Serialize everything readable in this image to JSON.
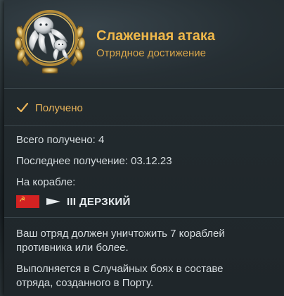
{
  "achievement": {
    "title": "Слаженная атака",
    "subtitle": "Отрядное достижение",
    "icon": "octopus-emblem-icon"
  },
  "status": {
    "icon": "checkmark-icon",
    "label": "Получено"
  },
  "stats": {
    "total_received": "Всего получено: 4",
    "last_received": "Последнее получение: 03.12.23",
    "on_ship_label": "На корабле:"
  },
  "ship": {
    "flag_icon": "ussr-flag-icon",
    "class_icon": "destroyer-icon",
    "name": "III ДЕРЗКИЙ"
  },
  "description": {
    "line1": "Ваш отряд должен уничтожить 7 кораблей",
    "line2": "противника или более.",
    "line3": "Выполняется в Случайных боях в составе",
    "line4": "отряда, созданного в Порту."
  },
  "colors": {
    "accent_gold": "#f0b84a",
    "text_light": "#d6dcdf",
    "panel_bg": "#222a2e"
  }
}
